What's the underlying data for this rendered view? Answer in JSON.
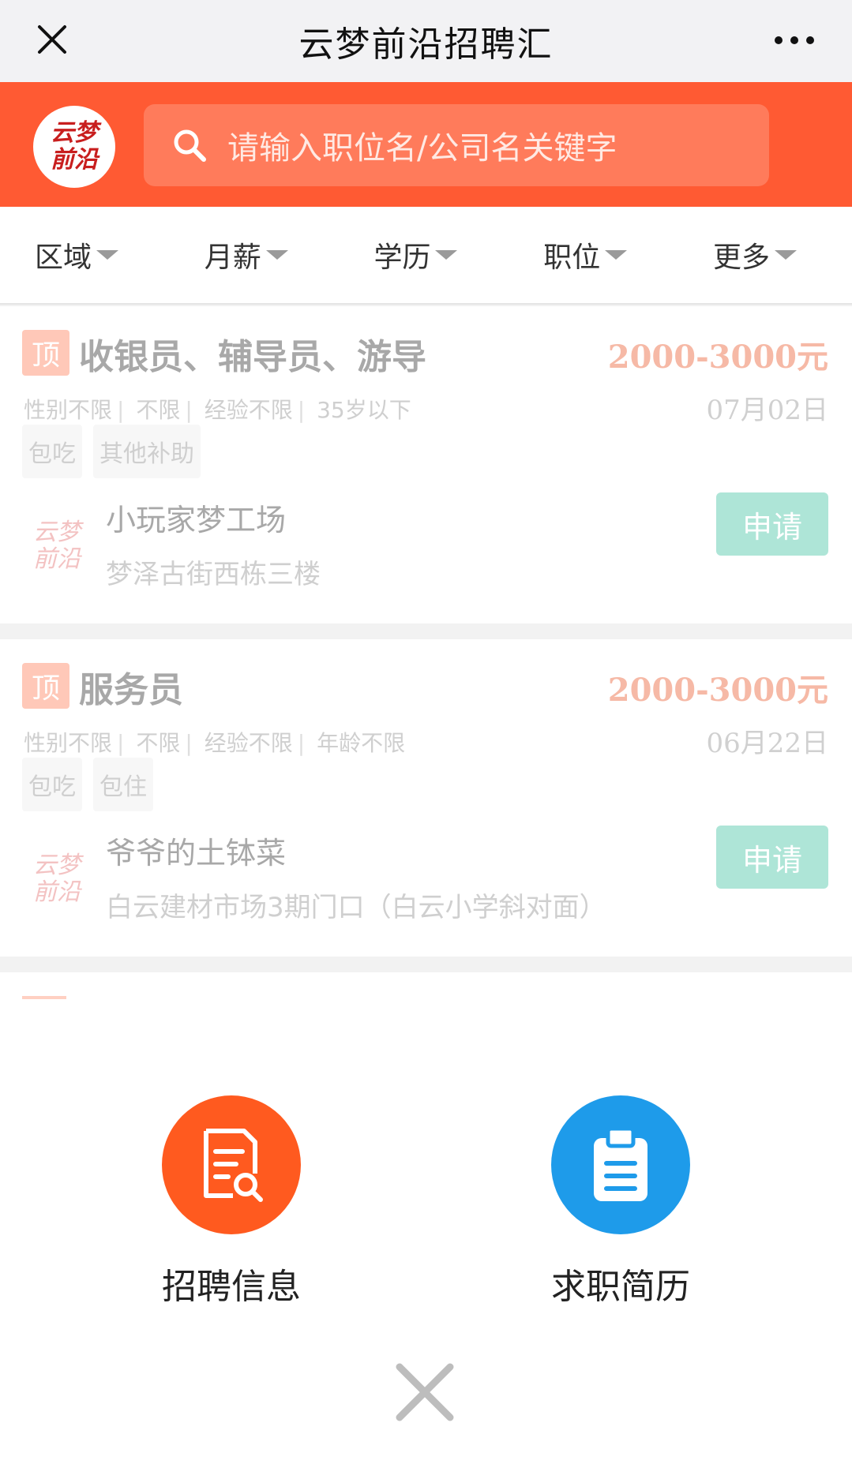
{
  "titlebar": {
    "close_icon": "close-icon",
    "title": "云梦前沿招聘汇",
    "more_icon": "more-dots-icon"
  },
  "header": {
    "logo_text": "云梦前沿",
    "search_placeholder": "请输入职位名/公司名关键字",
    "search_icon": "search-icon",
    "accent": "#ff5a33"
  },
  "filters": [
    {
      "label": "区域"
    },
    {
      "label": "月薪"
    },
    {
      "label": "学历"
    },
    {
      "label": "职位"
    },
    {
      "label": "更多"
    }
  ],
  "jobs": [
    {
      "badge": "顶",
      "title": "收银员、辅导员、游导",
      "salary": "2000-3000元",
      "meta": [
        "性别不限",
        "不限",
        "经验不限",
        "35岁以下"
      ],
      "date": "07月02日",
      "tags": [
        "包吃",
        "其他补助"
      ],
      "logo_text": "云梦前沿",
      "company": "小玩家梦工场",
      "address": "梦泽古街西栋三楼",
      "apply_label": "申请"
    },
    {
      "badge": "顶",
      "title": "服务员",
      "salary": "2000-3000元",
      "meta": [
        "性别不限",
        "不限",
        "经验不限",
        "年龄不限"
      ],
      "date": "06月22日",
      "tags": [
        "包吃",
        "包住"
      ],
      "logo_text": "云梦前沿",
      "company": "爷爷的土钵菜",
      "address": "白云建材市场3期门口（白云小学斜对面）",
      "apply_label": "申请"
    }
  ],
  "actions": [
    {
      "label": "招聘信息",
      "icon": "job-search-document-icon",
      "color": "#ff5a1f"
    },
    {
      "label": "求职简历",
      "icon": "clipboard-resume-icon",
      "color": "#1e9bea"
    }
  ],
  "overlay": {
    "close_icon": "close-icon"
  }
}
